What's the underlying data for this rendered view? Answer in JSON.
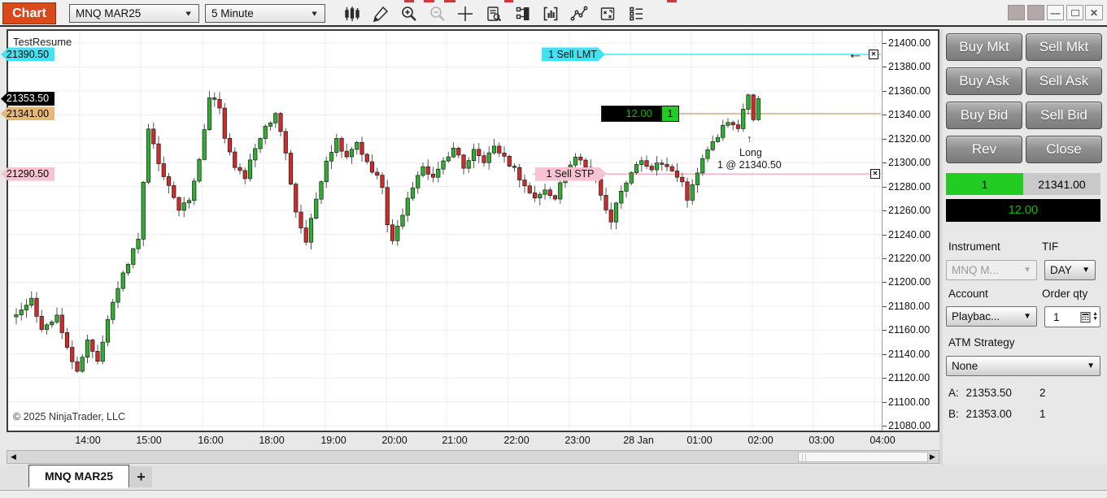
{
  "titlebar": {
    "app_label": "Chart",
    "instrument_select": "MNQ MAR25",
    "interval_select": "5 Minute",
    "toolbar_icons": [
      "bar-type-icon",
      "drawing-tools-icon",
      "zoom-in-icon",
      "zoom-out-icon",
      "crosshair-icon",
      "data-box-icon",
      "indicators-icon",
      "chart-trader-icon",
      "trend-line-icon",
      "strategies-icon",
      "properties-icon"
    ]
  },
  "chart": {
    "watermark": "TestResume",
    "copyright": "© 2025 NinjaTrader, LLC",
    "orders": {
      "sell_limit": {
        "label": "1 Sell LMT",
        "price": 21390.5,
        "price_label": "21390.50",
        "color": "#3fe3f2"
      },
      "sell_stop": {
        "label": "1 Sell STP",
        "price": 21290.5,
        "price_label": "21290.50",
        "color": "#f7c3d2"
      },
      "position": {
        "pnl": "12.00",
        "qty": "1",
        "price": 21341.0,
        "price_label": "21341.00",
        "color": "#e5b877"
      },
      "last_price": {
        "price": 21353.5,
        "price_label": "21353.50",
        "color": "#000000"
      }
    },
    "annotation": {
      "direction": "Long",
      "fill_text": "1 @ 21340.50",
      "arrow": "↑"
    }
  },
  "chart_data": {
    "type": "candlestick",
    "instrument": "MNQ MAR25",
    "interval": "5 Minute",
    "ylim": [
      21080,
      21400
    ],
    "y_step": 20,
    "y_tick_labels": [
      "21400.00",
      "21380.00",
      "21360.00",
      "21340.00",
      "21320.00",
      "21300.00",
      "21280.00",
      "21260.00",
      "21240.00",
      "21220.00",
      "21200.00",
      "21180.00",
      "21160.00",
      "21140.00",
      "21120.00",
      "21100.00",
      "21080.00"
    ],
    "x_tick_labels": [
      "14:00",
      "15:00",
      "16:00",
      "18:00",
      "19:00",
      "20:00",
      "21:00",
      "22:00",
      "23:00",
      "28 Jan",
      "01:00",
      "02:00",
      "03:00",
      "04:00"
    ],
    "candle_count": 147,
    "last_price": 21353.5,
    "price_waypoints": [
      [
        0,
        21175
      ],
      [
        3,
        21185
      ],
      [
        5,
        21160
      ],
      [
        8,
        21172
      ],
      [
        10,
        21145
      ],
      [
        12,
        21124
      ],
      [
        14,
        21150
      ],
      [
        16,
        21136
      ],
      [
        18,
        21168
      ],
      [
        21,
        21208
      ],
      [
        24,
        21235
      ],
      [
        26,
        21330
      ],
      [
        28,
        21298
      ],
      [
        30,
        21283
      ],
      [
        32,
        21258
      ],
      [
        34,
        21270
      ],
      [
        36,
        21302
      ],
      [
        38,
        21356
      ],
      [
        40,
        21348
      ],
      [
        41,
        21320
      ],
      [
        43,
        21298
      ],
      [
        45,
        21288
      ],
      [
        47,
        21312
      ],
      [
        49,
        21330
      ],
      [
        51,
        21340
      ],
      [
        53,
        21308
      ],
      [
        55,
        21258
      ],
      [
        57,
        21235
      ],
      [
        59,
        21268
      ],
      [
        61,
        21300
      ],
      [
        63,
        21320
      ],
      [
        65,
        21304
      ],
      [
        67,
        21318
      ],
      [
        69,
        21300
      ],
      [
        71,
        21288
      ],
      [
        72,
        21278
      ],
      [
        73,
        21250
      ],
      [
        74,
        21235
      ],
      [
        76,
        21258
      ],
      [
        78,
        21280
      ],
      [
        80,
        21295
      ],
      [
        82,
        21288
      ],
      [
        84,
        21302
      ],
      [
        86,
        21312
      ],
      [
        88,
        21296
      ],
      [
        90,
        21310
      ],
      [
        92,
        21300
      ],
      [
        94,
        21312
      ],
      [
        96,
        21304
      ],
      [
        98,
        21294
      ],
      [
        100,
        21280
      ],
      [
        102,
        21270
      ],
      [
        104,
        21276
      ],
      [
        106,
        21270
      ],
      [
        108,
        21295
      ],
      [
        110,
        21305
      ],
      [
        112,
        21298
      ],
      [
        114,
        21288
      ],
      [
        116,
        21262
      ],
      [
        117,
        21252
      ],
      [
        119,
        21276
      ],
      [
        121,
        21292
      ],
      [
        123,
        21302
      ],
      [
        125,
        21295
      ],
      [
        127,
        21300
      ],
      [
        129,
        21294
      ],
      [
        131,
        21284
      ],
      [
        132,
        21270
      ],
      [
        134,
        21292
      ],
      [
        136,
        21312
      ],
      [
        138,
        21322
      ],
      [
        140,
        21336
      ],
      [
        142,
        21330
      ],
      [
        144,
        21356
      ],
      [
        145,
        21338
      ],
      [
        146,
        21353.5
      ]
    ],
    "colors": {
      "up": "#2faf2f",
      "down": "#ce2b2b",
      "wick": "#555555",
      "grid": "#ededed"
    }
  },
  "panel": {
    "buttons": [
      "Buy Mkt",
      "Sell Mkt",
      "Buy Ask",
      "Sell Ask",
      "Buy Bid",
      "Sell Bid",
      "Rev",
      "Close"
    ],
    "position_qty": "1",
    "position_price": "21341.00",
    "pnl": "12.00",
    "instrument_label": "Instrument",
    "instrument_value": "MNQ M...",
    "tif_label": "TIF",
    "tif_value": "DAY",
    "account_label": "Account",
    "account_value": "Playbac...",
    "order_qty_label": "Order qty",
    "order_qty_value": "1",
    "atm_label": "ATM Strategy",
    "atm_value": "None",
    "ask_row": {
      "prefix": "A:",
      "price": "21353.50",
      "size": "2"
    },
    "bid_row": {
      "prefix": "B:",
      "price": "21353.00",
      "size": "1"
    }
  },
  "tabs": {
    "active": "MNQ MAR25",
    "add": "+"
  }
}
